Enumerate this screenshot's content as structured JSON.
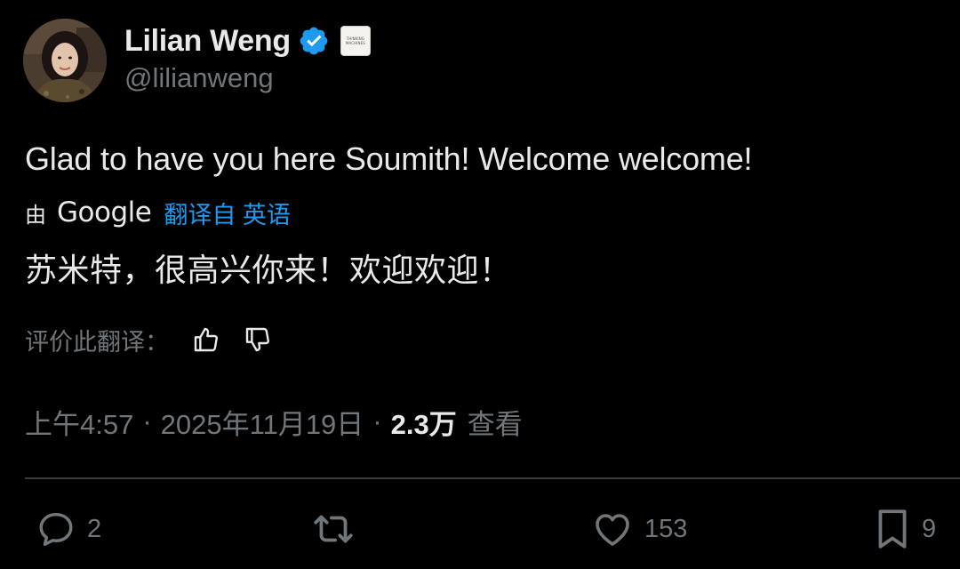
{
  "author": {
    "display_name": "Lilian Weng",
    "handle": "@lilianweng",
    "verified": true,
    "avatar_icon": "profile-photo",
    "affiliate_badge_text": [
      "THINKING",
      "MACHINES"
    ]
  },
  "tweet": {
    "text": "Glad to have you here Soumith! Welcome welcome!"
  },
  "translation": {
    "by_label": "由",
    "provider": "Google",
    "from_label": "翻译自 英语",
    "text": "苏米特，很高兴你来！欢迎欢迎！",
    "rate_label": "评价此翻译：",
    "rate_up_icon": "thumbs-up-icon",
    "rate_down_icon": "thumbs-down-icon"
  },
  "meta": {
    "time": "上午4:57",
    "separator": "·",
    "date": "2025年11月19日",
    "views_count": "2.3万",
    "views_label": "查看"
  },
  "actions": {
    "reply_count": "2",
    "retweet_count": "",
    "like_count": "153",
    "bookmark_count": "9"
  },
  "colors": {
    "background": "#000000",
    "text_primary": "#e7e9ea",
    "text_secondary": "#71767b",
    "accent_link": "#1d9bf0",
    "divider": "#3e3a37"
  }
}
